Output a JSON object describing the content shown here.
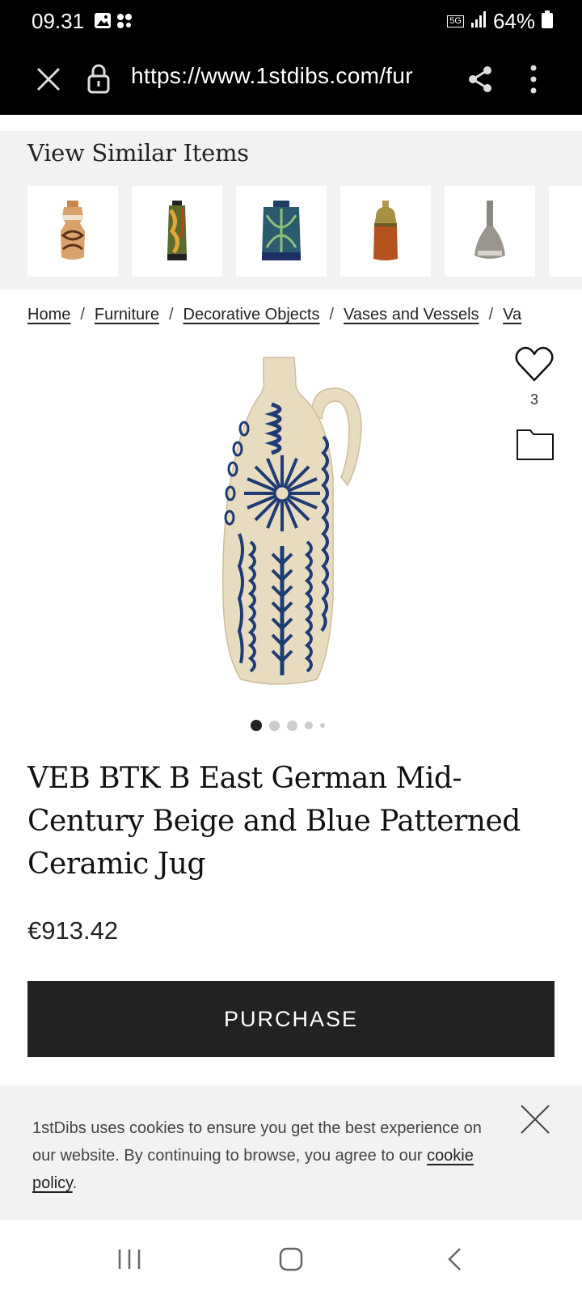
{
  "status": {
    "time": "09.31",
    "network": "5G",
    "battery": "64%"
  },
  "browser": {
    "url": "https://www.1stdibs.com/fur"
  },
  "similar": {
    "title": "View Similar Items",
    "items": [
      {
        "icon": "orange-brown-vase-thumb"
      },
      {
        "icon": "green-yellow-vase-thumb"
      },
      {
        "icon": "blue-patterned-vase-thumb"
      },
      {
        "icon": "orange-olive-vase-thumb"
      },
      {
        "icon": "grey-bottle-vase-thumb"
      }
    ]
  },
  "breadcrumb": {
    "home": "Home",
    "furniture": "Furniture",
    "decorative": "Decorative Objects",
    "vases": "Vases and Vessels",
    "next": "Va",
    "separator": "/"
  },
  "product": {
    "favorites_count": "3",
    "title": "VEB BTK B East German Mid-Century Beige and Blue Patterned Ceramic Jug",
    "price": "€913.42",
    "purchase_label": "PURCHASE",
    "carousel_total": 5,
    "carousel_active": 1
  },
  "cookie": {
    "text": "1stDibs uses cookies to ensure you get the best experience on our website. By continuing to browse, you agree to our ",
    "link": "cookie policy",
    "end": "."
  },
  "colors": {
    "ink": "#222222",
    "panel": "#f2f2f2",
    "jug_blue": "#1f3b74",
    "jug_beige": "#e8dcc0"
  }
}
